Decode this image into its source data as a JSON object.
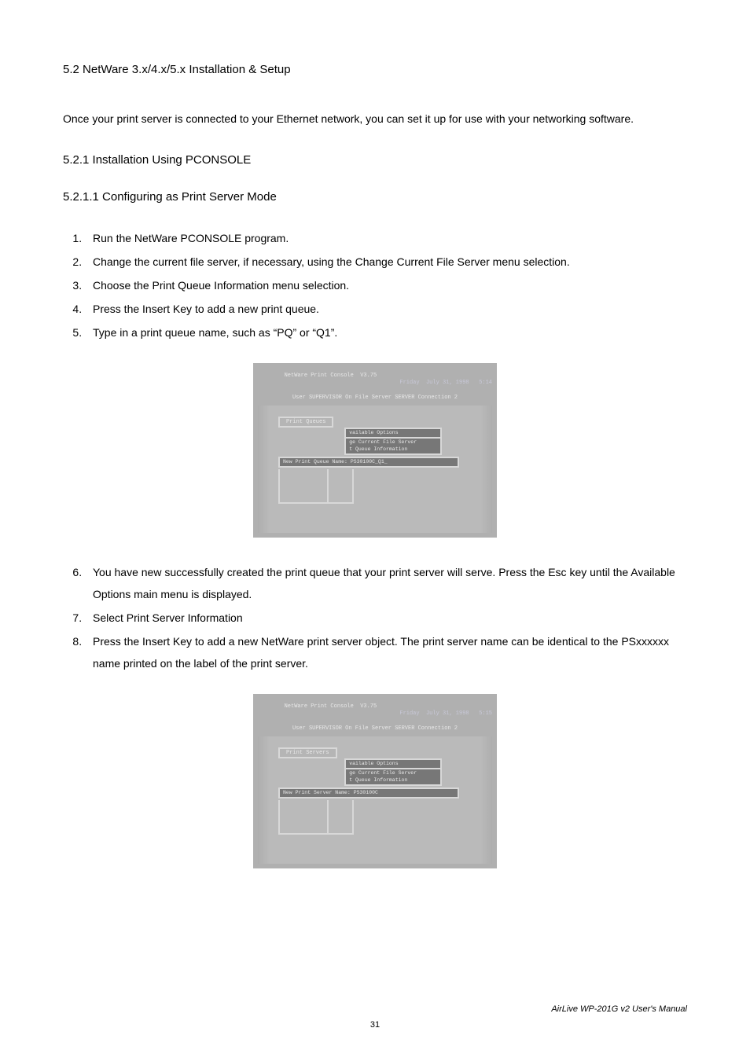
{
  "section_heading": "5.2 NetWare 3.x/4.x/5.x Installation & Setup",
  "intro_para": "Once your print server is connected to your Ethernet network, you can set it up for use with your networking software.",
  "sub_heading_1": "5.2.1 Installation Using PCONSOLE",
  "sub_heading_2": "5.2.1.1 Configuring as Print Server Mode",
  "steps_a": [
    "Run the NetWare PCONSOLE program.",
    "Change the current file server, if necessary, using the Change Current File Server menu selection.",
    "Choose the Print Queue Information menu selection.",
    "Press the Insert Key to add a new print queue.",
    "Type in a print queue name, such as “PQ” or “Q1”."
  ],
  "screenshot1": {
    "app_title": "NetWare Print Console  V3.75",
    "date": "Friday  July 31, 1998   5:14",
    "connection": "User SUPERVISOR On File Server SERVER Connection 2",
    "panel_title": "Print Queues",
    "options_header": "vailable Options",
    "options_lines": "ge Current File Server\nt Queue Information",
    "input_label": "New Print Queue Name: PS30100C_Q1_"
  },
  "steps_b": [
    "You have new successfully created the print queue that your print server will serve. Press the Esc key until the Available Options main menu is displayed.",
    "Select Print Server Information",
    "Press the Insert Key to add a new NetWare print server object. The print server name can be identical to the PSxxxxxx name printed on the label of the print server."
  ],
  "screenshot2": {
    "app_title": "NetWare Print Console  V3.75",
    "date": "Friday  July 31, 1998   5:15",
    "connection": "User SUPERVISOR On File Server SERVER Connection 2",
    "panel_title": "Print Servers",
    "options_header": "vailable Options",
    "options_lines": "ge Current File Server\nt Queue Information",
    "input_label": "New Print Server Name: PS30100C"
  },
  "footer_text": "AirLive WP-201G v2 User's Manual",
  "page_number": "31"
}
